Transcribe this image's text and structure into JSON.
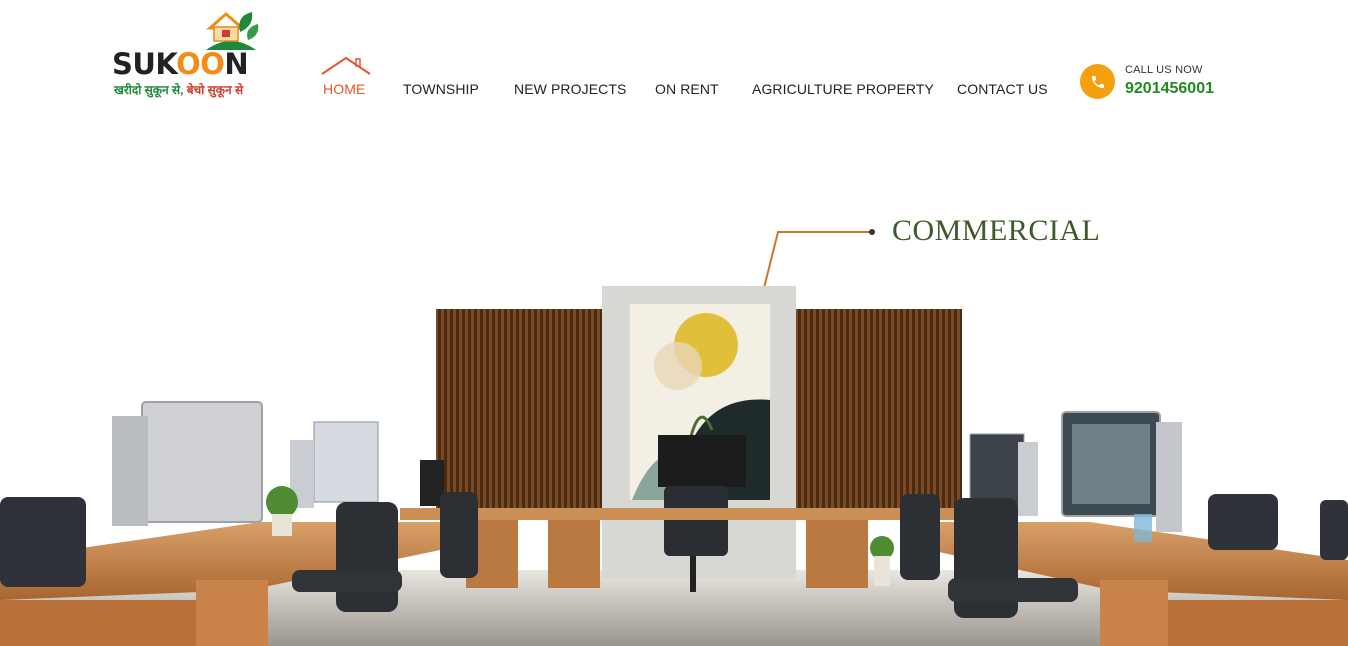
{
  "brand": {
    "name_part1": "SUK",
    "name_highlight": "OO",
    "name_part2": "N",
    "tagline_part1": "खरीदो सुकून से,",
    "tagline_part2": "बेचो सुकून से",
    "logo_icon": "house-leaf-icon"
  },
  "nav": {
    "items": [
      {
        "label": "HOME",
        "active": true
      },
      {
        "label": "TOWNSHIP"
      },
      {
        "label": "NEW PROJECTS"
      },
      {
        "label": "ON RENT"
      },
      {
        "label": "AGRICULTURE PROPERTY"
      },
      {
        "label": "CONTACT US"
      }
    ],
    "active_icon": "roof-icon"
  },
  "call": {
    "label": "CALL US NOW",
    "number": "9201456001",
    "icon": "phone-icon"
  },
  "hero": {
    "label": "COMMERCIAL"
  },
  "colors": {
    "accent_orange": "#f5a011",
    "active_nav": "#e4572e",
    "phone_green": "#1f8a1f",
    "label_green": "#3d5a2a"
  }
}
